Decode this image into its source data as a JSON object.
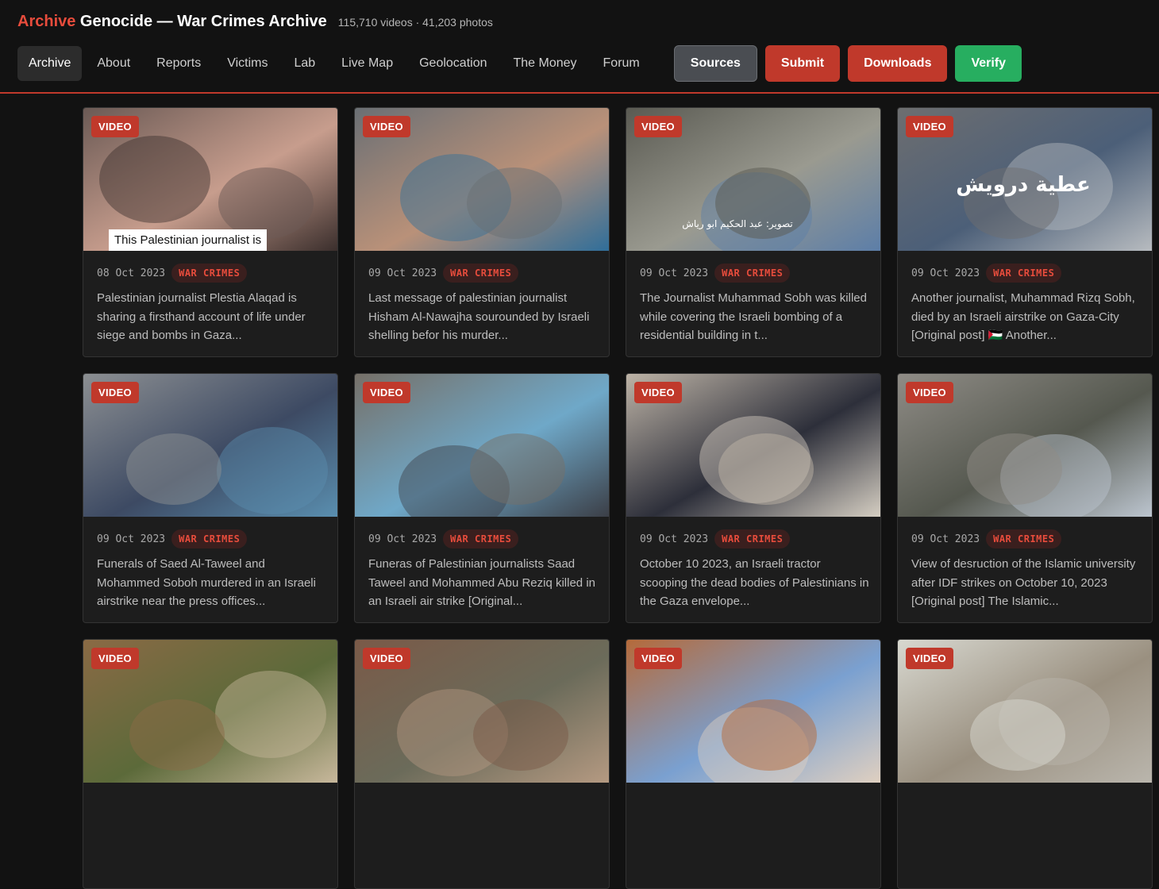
{
  "header": {
    "brand_accent": "Archive",
    "brand_rest": " Genocide — War Crimes Archive",
    "stats": "115,710 videos · 41,203 photos",
    "nav": [
      {
        "label": "Archive",
        "active": true
      },
      {
        "label": "About"
      },
      {
        "label": "Reports"
      },
      {
        "label": "Victims"
      },
      {
        "label": "Lab"
      },
      {
        "label": "Live Map"
      },
      {
        "label": "Geolocation"
      },
      {
        "label": "The Money"
      },
      {
        "label": "Forum"
      }
    ],
    "buttons": {
      "sources": "Sources",
      "submit": "Submit",
      "downloads": "Downloads",
      "verify": "Verify"
    }
  },
  "colors": {
    "accent": "#c0392b",
    "verify": "#27ae60",
    "background": "#121212",
    "card": "#1d1d1d"
  },
  "cards": [
    {
      "badge": "VIDEO",
      "date": "08 Oct 2023",
      "tag": "WAR CRIMES",
      "overlay": "This Palestinian journalist is",
      "desc": "Palestinian journalist Plestia Alaqad is sharing a firsthand account of life under siege and bombs in Gaza..."
    },
    {
      "badge": "VIDEO",
      "date": "09 Oct 2023",
      "tag": "WAR CRIMES",
      "desc": "Last message of palestinian journalist Hisham Al-Nawajha sourounded by Israeli shelling befor his murder..."
    },
    {
      "badge": "VIDEO",
      "date": "09 Oct 2023",
      "tag": "WAR CRIMES",
      "overlay_ar": "تصوير: عبد الحكيم ابو رياش",
      "desc": "The Journalist Muhammad Sobh was killed while covering the Israeli bombing of a residential building in t..."
    },
    {
      "badge": "VIDEO",
      "date": "09 Oct 2023",
      "tag": "WAR CRIMES",
      "overlay_ar": "عطية درويش",
      "desc": "Another journalist, Muhammad Rizq Sobh, died by an Israeli airstrike on Gaza-City [Original post] 🇵🇸 Another..."
    },
    {
      "badge": "VIDEO",
      "date": "09 Oct 2023",
      "tag": "WAR CRIMES",
      "desc": "Funerals of Saed Al-Taweel and Mohammed Soboh murdered in an Israeli airstrike near the press offices..."
    },
    {
      "badge": "VIDEO",
      "date": "09 Oct 2023",
      "tag": "WAR CRIMES",
      "desc": "Funeras of Palestinian journalists Saad Taweel and Mohammed Abu Reziq killed in an Israeli air strike [Original..."
    },
    {
      "badge": "VIDEO",
      "date": "09 Oct 2023",
      "tag": "WAR CRIMES",
      "desc": "October 10 2023, an Israeli tractor scooping the dead bodies of Palestinians in the Gaza envelope..."
    },
    {
      "badge": "VIDEO",
      "date": "09 Oct 2023",
      "tag": "WAR CRIMES",
      "desc": "View of desruction of the Islamic university after IDF strikes on October 10, 2023 [Original post] The Islamic..."
    },
    {
      "badge": "VIDEO"
    },
    {
      "badge": "VIDEO"
    },
    {
      "badge": "VIDEO"
    },
    {
      "badge": "VIDEO"
    }
  ],
  "thumb_palettes": [
    [
      "#6b5a55",
      "#c79d8d",
      "#3a2e2c"
    ],
    [
      "#6a6f74",
      "#b99179",
      "#2f6e9a"
    ],
    [
      "#5a5a52",
      "#9a9a90",
      "#5c7ea8"
    ],
    [
      "#6d6e70",
      "#4c5f78",
      "#b8bcc0"
    ],
    [
      "#8c8f92",
      "#3d4a63",
      "#5a8fb0"
    ],
    [
      "#767068",
      "#6fa8c8",
      "#3b3e46"
    ],
    [
      "#bdb3a6",
      "#2d2f3a",
      "#d6cfc3"
    ],
    [
      "#8f8c86",
      "#55584f",
      "#bdc6d0"
    ],
    [
      "#8a6a45",
      "#5c6a3a",
      "#c8b89c"
    ],
    [
      "#7a5a48",
      "#6b6b5a",
      "#b59a82"
    ],
    [
      "#b56a3a",
      "#7aa0d0",
      "#e0d0c0"
    ],
    [
      "#d8d8d0",
      "#9a9080",
      "#bab6ad"
    ]
  ]
}
